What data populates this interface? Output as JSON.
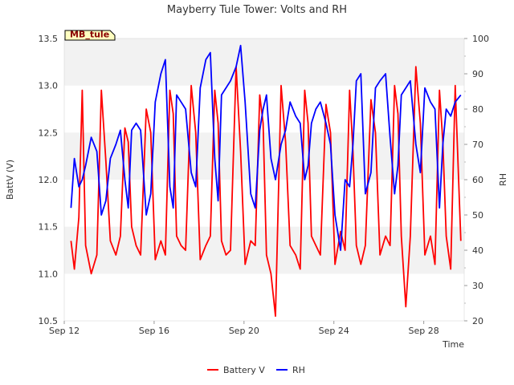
{
  "chart_data": {
    "type": "line",
    "title": "Mayberry Tule Tower: Volts and RH",
    "xlabel": "Time",
    "ylabel": "BattV (V)",
    "y2label": "RH",
    "site_tag": "MB_tule",
    "x_ticks": [
      "Sep 12",
      "Sep 16",
      "Sep 20",
      "Sep 24",
      "Sep 28"
    ],
    "x_range_days": [
      12,
      29.8
    ],
    "y_ticks": [
      "10.5",
      "11.0",
      "11.5",
      "12.0",
      "12.5",
      "13.0",
      "13.5"
    ],
    "ylim": [
      10.5,
      13.5
    ],
    "y2_ticks": [
      "20",
      "30",
      "40",
      "50",
      "60",
      "70",
      "80",
      "90",
      "100"
    ],
    "y2lim": [
      20,
      100
    ],
    "grid": "horizontal bands",
    "legend_position": "bottom-center",
    "colors": {
      "battery": "#ff0000",
      "rh": "#0000ff",
      "band": "#f2f2f2",
      "tag_fill": "#ffffc0",
      "tag_text": "#8b0000"
    },
    "series": [
      {
        "name": "Battery V",
        "axis": "left",
        "x": [
          12.3,
          12.45,
          12.65,
          12.8,
          12.95,
          13.2,
          13.45,
          13.65,
          13.85,
          14.05,
          14.3,
          14.5,
          14.7,
          14.85,
          15.0,
          15.2,
          15.4,
          15.65,
          15.85,
          16.05,
          16.3,
          16.5,
          16.7,
          16.85,
          17.0,
          17.2,
          17.4,
          17.65,
          17.85,
          18.05,
          18.3,
          18.5,
          18.7,
          18.85,
          19.0,
          19.2,
          19.4,
          19.65,
          19.85,
          20.05,
          20.3,
          20.5,
          20.7,
          20.85,
          21.0,
          21.2,
          21.4,
          21.65,
          21.85,
          22.05,
          22.3,
          22.5,
          22.7,
          22.85,
          23.0,
          23.2,
          23.4,
          23.65,
          23.85,
          24.05,
          24.3,
          24.5,
          24.7,
          24.85,
          25.0,
          25.2,
          25.4,
          25.65,
          25.85,
          26.05,
          26.3,
          26.5,
          26.7,
          26.85,
          27.0,
          27.2,
          27.4,
          27.65,
          27.85,
          28.05,
          28.3,
          28.5,
          28.7,
          28.85,
          29.0,
          29.2,
          29.4,
          29.65
        ],
        "values": [
          11.35,
          11.05,
          11.6,
          12.95,
          11.3,
          11.0,
          11.2,
          12.95,
          12.2,
          11.35,
          11.2,
          11.4,
          12.55,
          12.4,
          11.5,
          11.3,
          11.2,
          12.75,
          12.5,
          11.15,
          11.35,
          11.2,
          12.95,
          12.7,
          11.4,
          11.3,
          11.25,
          13.0,
          12.5,
          11.15,
          11.3,
          11.4,
          12.95,
          12.6,
          11.35,
          11.2,
          11.25,
          13.2,
          12.3,
          11.1,
          11.35,
          11.3,
          12.9,
          12.6,
          11.2,
          11.0,
          10.55,
          13.0,
          12.4,
          11.3,
          11.2,
          11.05,
          12.95,
          12.6,
          11.4,
          11.3,
          11.2,
          12.8,
          12.5,
          11.1,
          11.45,
          11.25,
          12.95,
          12.3,
          11.3,
          11.1,
          11.3,
          12.85,
          12.5,
          11.2,
          11.4,
          11.3,
          13.0,
          12.7,
          11.4,
          10.65,
          11.4,
          13.2,
          12.6,
          11.2,
          11.4,
          11.1,
          12.95,
          12.4,
          11.4,
          11.05,
          13.0,
          11.35
        ]
      },
      {
        "name": "RH",
        "axis": "right",
        "x": [
          12.3,
          12.45,
          12.65,
          12.8,
          12.95,
          13.2,
          13.45,
          13.65,
          13.85,
          14.05,
          14.3,
          14.5,
          14.7,
          14.85,
          15.0,
          15.2,
          15.4,
          15.65,
          15.85,
          16.05,
          16.3,
          16.5,
          16.7,
          16.85,
          17.0,
          17.2,
          17.4,
          17.65,
          17.85,
          18.05,
          18.3,
          18.5,
          18.7,
          18.85,
          19.0,
          19.2,
          19.4,
          19.65,
          19.85,
          20.05,
          20.3,
          20.5,
          20.7,
          20.85,
          21.0,
          21.2,
          21.4,
          21.65,
          21.85,
          22.05,
          22.3,
          22.5,
          22.7,
          22.85,
          23.0,
          23.2,
          23.4,
          23.65,
          23.85,
          24.05,
          24.3,
          24.5,
          24.7,
          24.85,
          25.0,
          25.2,
          25.4,
          25.65,
          25.85,
          26.05,
          26.3,
          26.5,
          26.7,
          26.85,
          27.0,
          27.2,
          27.4,
          27.65,
          27.85,
          28.05,
          28.3,
          28.5,
          28.7,
          28.85,
          29.0,
          29.2,
          29.4,
          29.65
        ],
        "values": [
          52,
          66,
          58,
          60,
          64,
          72,
          68,
          50,
          54,
          66,
          70,
          74,
          60,
          52,
          74,
          76,
          74,
          50,
          56,
          82,
          90,
          94,
          58,
          52,
          84,
          82,
          80,
          62,
          58,
          86,
          94,
          96,
          66,
          54,
          84,
          86,
          88,
          92,
          98,
          82,
          56,
          52,
          74,
          80,
          84,
          66,
          60,
          70,
          74,
          82,
          78,
          76,
          60,
          64,
          76,
          80,
          82,
          76,
          70,
          50,
          40,
          60,
          58,
          70,
          88,
          90,
          56,
          62,
          86,
          88,
          90,
          72,
          56,
          64,
          84,
          86,
          88,
          70,
          62,
          86,
          82,
          80,
          52,
          70,
          80,
          78,
          82,
          84
        ]
      }
    ]
  }
}
